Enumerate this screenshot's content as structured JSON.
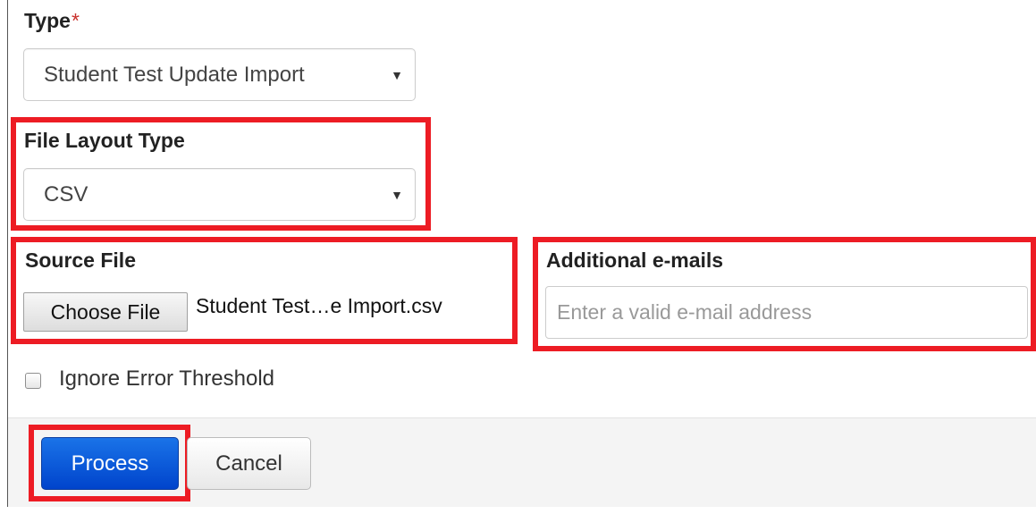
{
  "form": {
    "type": {
      "label": "Type",
      "required_marker": "*",
      "selected": "Student Test Update Import"
    },
    "file_layout_type": {
      "label": "File Layout Type",
      "selected": "CSV"
    },
    "source_file": {
      "label": "Source File",
      "button_label": "Choose File",
      "file_name": "Student Test…e Import.csv"
    },
    "additional_emails": {
      "label": "Additional e-mails",
      "placeholder": "Enter a valid e-mail address",
      "value": ""
    },
    "ignore_error_threshold": {
      "label": "Ignore Error Threshold",
      "checked": false
    }
  },
  "footer": {
    "process_label": "Process",
    "cancel_label": "Cancel"
  },
  "icons": {
    "dropdown_caret": "▼"
  },
  "colors": {
    "highlight": "#ed1c24",
    "primary": "#0a55d9",
    "required": "#c9302c"
  }
}
